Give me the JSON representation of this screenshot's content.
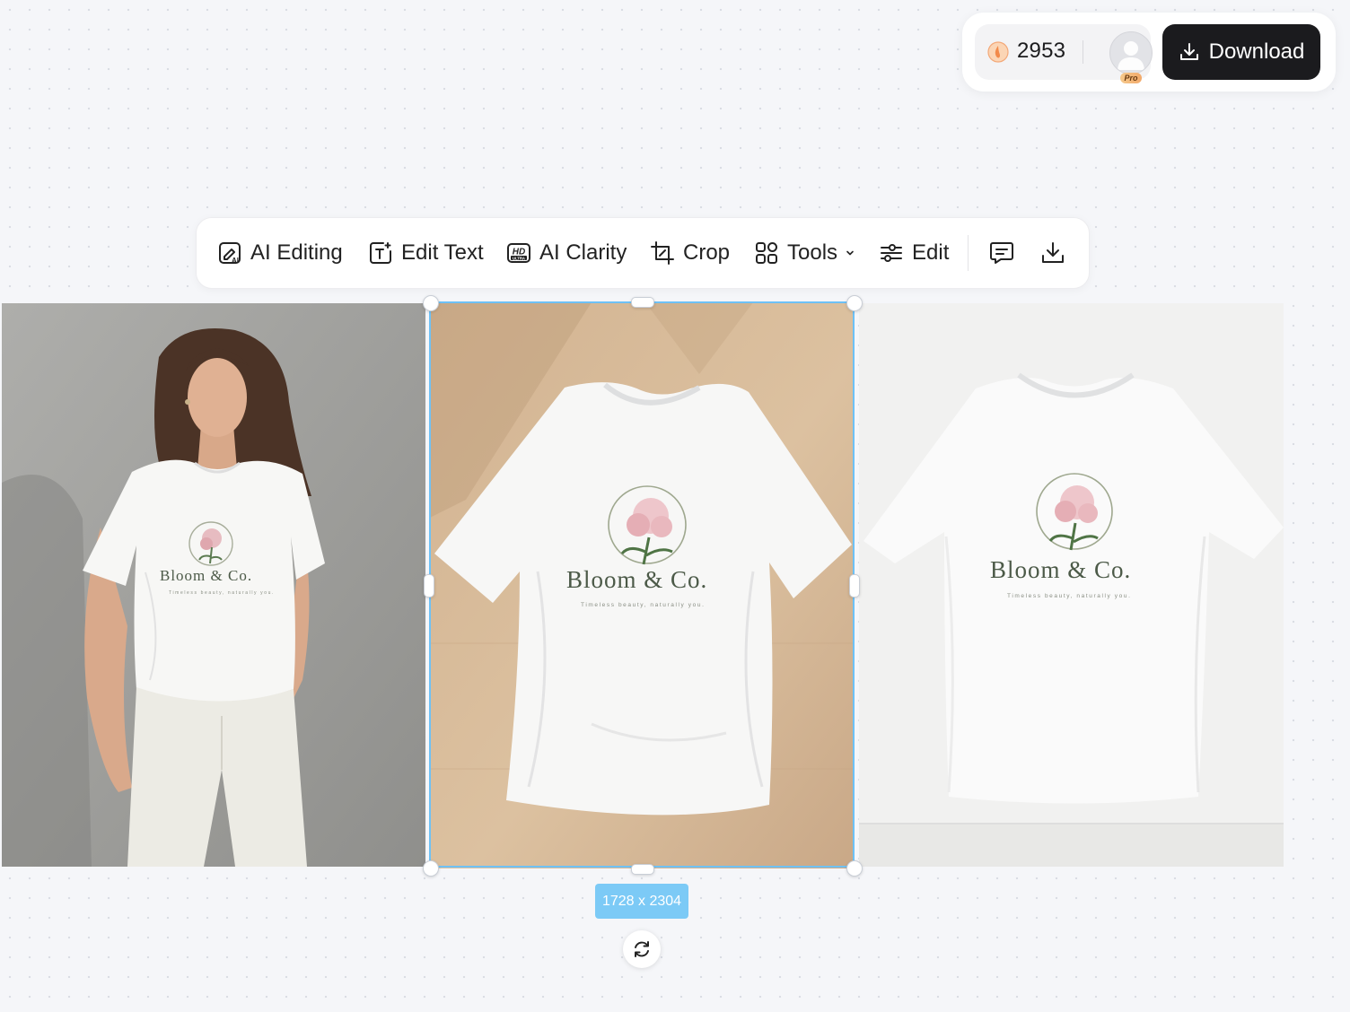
{
  "account": {
    "credits": "2953",
    "coin_icon": "coin-icon",
    "plan_badge": "Pro",
    "download_label": "Download"
  },
  "toolbar": {
    "items": [
      {
        "label": "AI Editing",
        "icon": "ai-edit-icon"
      },
      {
        "label": "Edit Text",
        "icon": "text-edit-icon"
      },
      {
        "label": "AI Clarity",
        "icon": "hd-ultra-icon",
        "icon_text": "HD",
        "icon_subtext": "ULTRA"
      },
      {
        "label": "Crop",
        "icon": "crop-icon"
      },
      {
        "label": "Tools",
        "icon": "grid-icon"
      },
      {
        "label": "Edit",
        "icon": "sliders-icon"
      }
    ],
    "comment_icon": "comment-icon",
    "download_icon": "download-icon"
  },
  "images": [
    {
      "description": "model-wearing-tshirt",
      "brand": "Bloom & Co.",
      "tagline": "Timeless beauty, naturally you."
    },
    {
      "description": "tshirt-flatlay-on-wood",
      "brand": "Bloom & Co.",
      "tagline": "Timeless beauty, naturally you.",
      "selected": true
    },
    {
      "description": "tshirt-on-white-wall",
      "brand": "Bloom & Co.",
      "tagline": "Timeless beauty, naturally you."
    }
  ],
  "selection": {
    "dimensions": "1728 x 2304",
    "regenerate_icon": "refresh-icon"
  },
  "colors": {
    "accent": "#6ec1f5",
    "badge": "#7ccaf6",
    "button_dark": "#1b1b1e",
    "background": "#f5f6f9"
  }
}
